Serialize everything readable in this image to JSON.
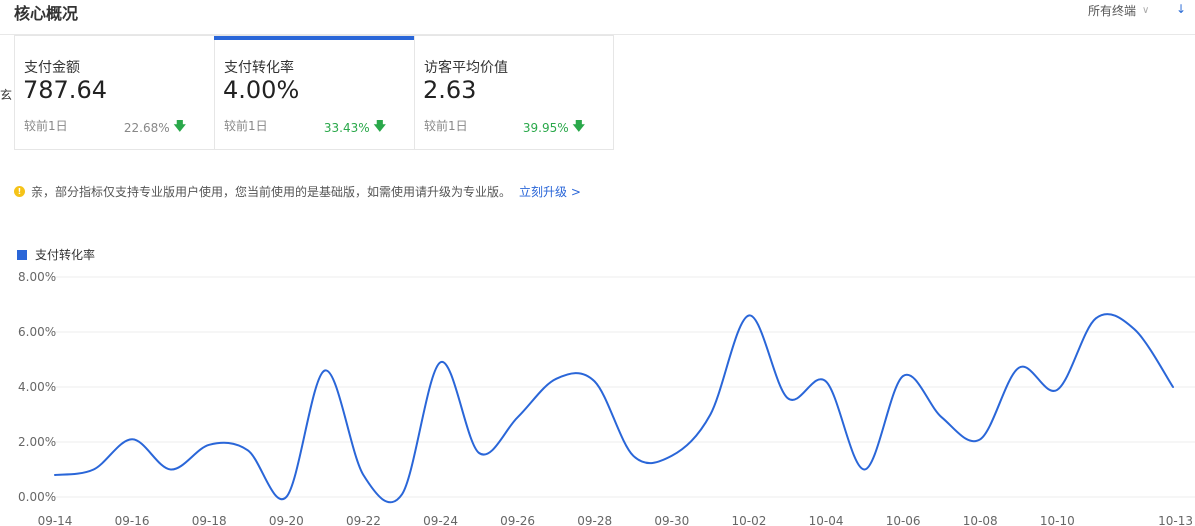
{
  "header": {
    "title": "核心概况",
    "terminal_label": "所有终端",
    "download_glyph": "↓"
  },
  "left_edge_text": "玄",
  "cards": [
    {
      "title": "支付金额",
      "value": "787.64",
      "compare_label": "较前1日",
      "change": "22.68%",
      "change_style": "gray",
      "active": false
    },
    {
      "title": "支付转化率",
      "value": "4.00%",
      "compare_label": "较前1日",
      "change": "33.43%",
      "change_style": "green",
      "active": true
    },
    {
      "title": "访客平均价值",
      "value": "2.63",
      "compare_label": "较前1日",
      "change": "39.95%",
      "change_style": "green",
      "active": false
    }
  ],
  "notice": {
    "text": "亲，部分指标仅支持专业版用户使用，您当前使用的是基础版，如需使用请升级为专业版。",
    "link": "立刻升级 >"
  },
  "colors": {
    "accent": "#2a66d8",
    "down": "#2aa84a",
    "warning": "#f5c318"
  },
  "chart_data": {
    "type": "line",
    "series": [
      {
        "name": "支付转化率",
        "values": [
          0.8,
          1.0,
          2.1,
          1.0,
          1.9,
          1.7,
          0.0,
          4.6,
          0.8,
          0.1,
          4.9,
          1.6,
          2.9,
          4.3,
          4.2,
          1.5,
          1.5,
          3.0,
          6.6,
          3.6,
          4.2,
          1.0,
          4.4,
          2.9,
          2.1,
          4.7,
          3.9,
          6.5,
          6.1,
          4.0
        ]
      }
    ],
    "x": [
      "09-14",
      "09-15",
      "09-16",
      "09-17",
      "09-18",
      "09-19",
      "09-20",
      "09-21",
      "09-22",
      "09-23",
      "09-24",
      "09-25",
      "09-26",
      "09-27",
      "09-28",
      "09-29",
      "09-30",
      "10-01",
      "10-02",
      "10-03",
      "10-04",
      "10-05",
      "10-06",
      "10-07",
      "10-08",
      "10-09",
      "10-10",
      "10-11",
      "10-12",
      "10-13"
    ],
    "x_tick_labels": [
      "09-14",
      "09-16",
      "09-18",
      "09-20",
      "09-22",
      "09-24",
      "09-26",
      "09-28",
      "09-30",
      "10-02",
      "10-04",
      "10-06",
      "10-08",
      "10-10",
      "10-13"
    ],
    "y_ticks": [
      "0.00%",
      "2.00%",
      "4.00%",
      "6.00%",
      "8.00%"
    ],
    "ylim": [
      0,
      8
    ],
    "grid": true,
    "legend_position": "top-left"
  }
}
